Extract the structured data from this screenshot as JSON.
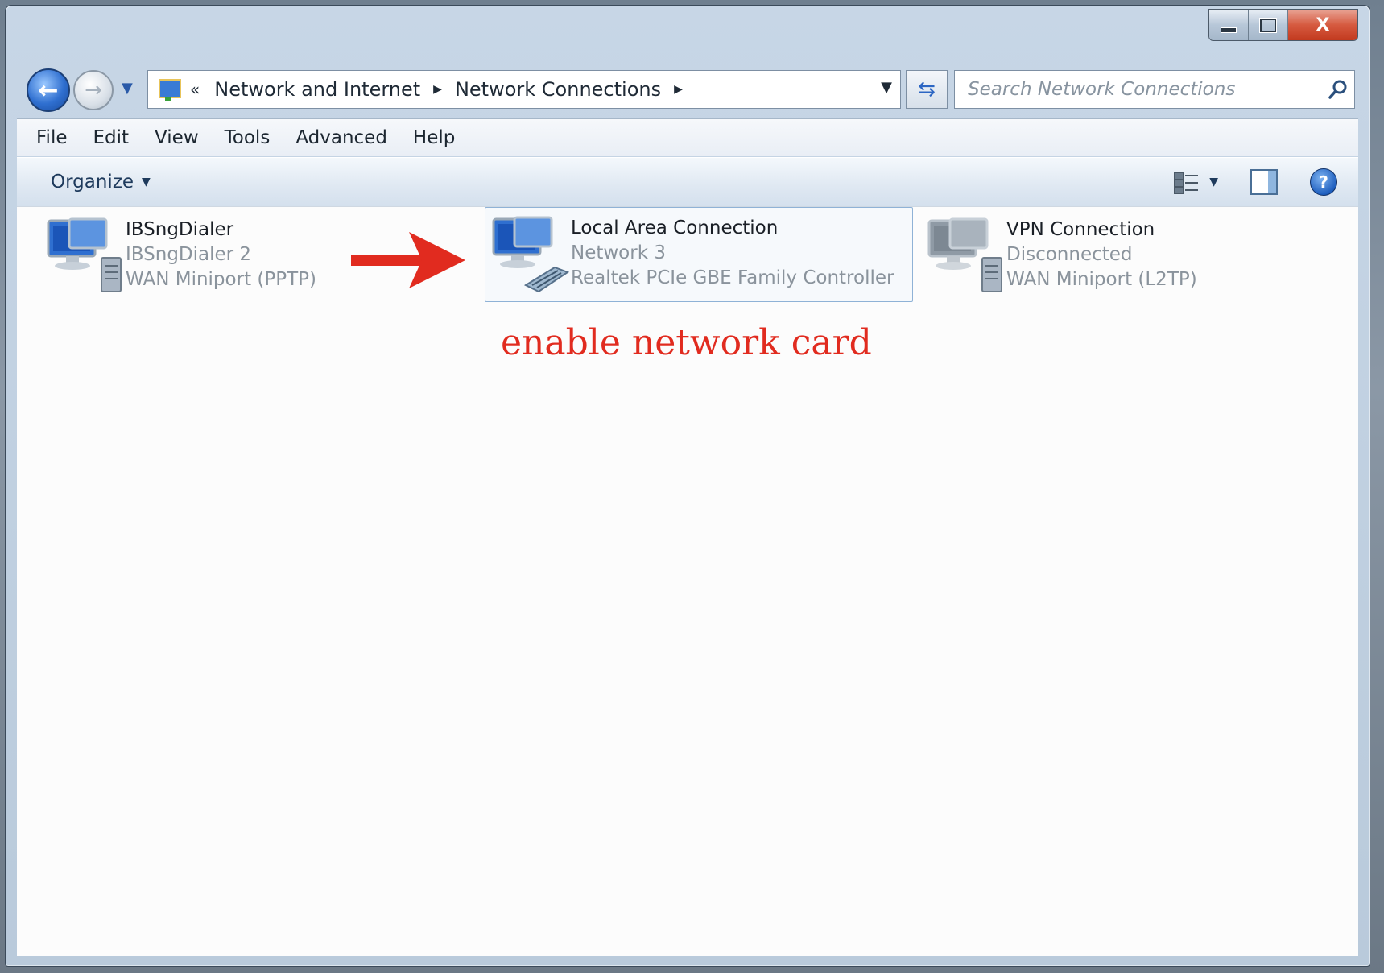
{
  "window": {
    "caption": {
      "minimize": "",
      "maximize": "",
      "close": "X"
    }
  },
  "address": {
    "overflow_chevron": "«",
    "crumbs": [
      "Network and Internet",
      "Network Connections"
    ],
    "search_placeholder": "Search Network Connections"
  },
  "menu": [
    "File",
    "Edit",
    "View",
    "Tools",
    "Advanced",
    "Help"
  ],
  "toolbar": {
    "organize": "Organize"
  },
  "connections": [
    {
      "name": "IBSngDialer",
      "line2": "IBSngDialer 2",
      "line3": "WAN Miniport (PPTP)",
      "selected": false,
      "device": "server"
    },
    {
      "name": "Local Area Connection",
      "line2": "Network 3",
      "line3": "Realtek PCIe GBE Family Controller",
      "selected": true,
      "device": "nic"
    },
    {
      "name": "VPN Connection",
      "line2": "Disconnected",
      "line3": "WAN Miniport (L2TP)",
      "selected": false,
      "device": "server-gray"
    }
  ],
  "annotation": {
    "text": "enable network card",
    "color": "#e12b1f"
  }
}
